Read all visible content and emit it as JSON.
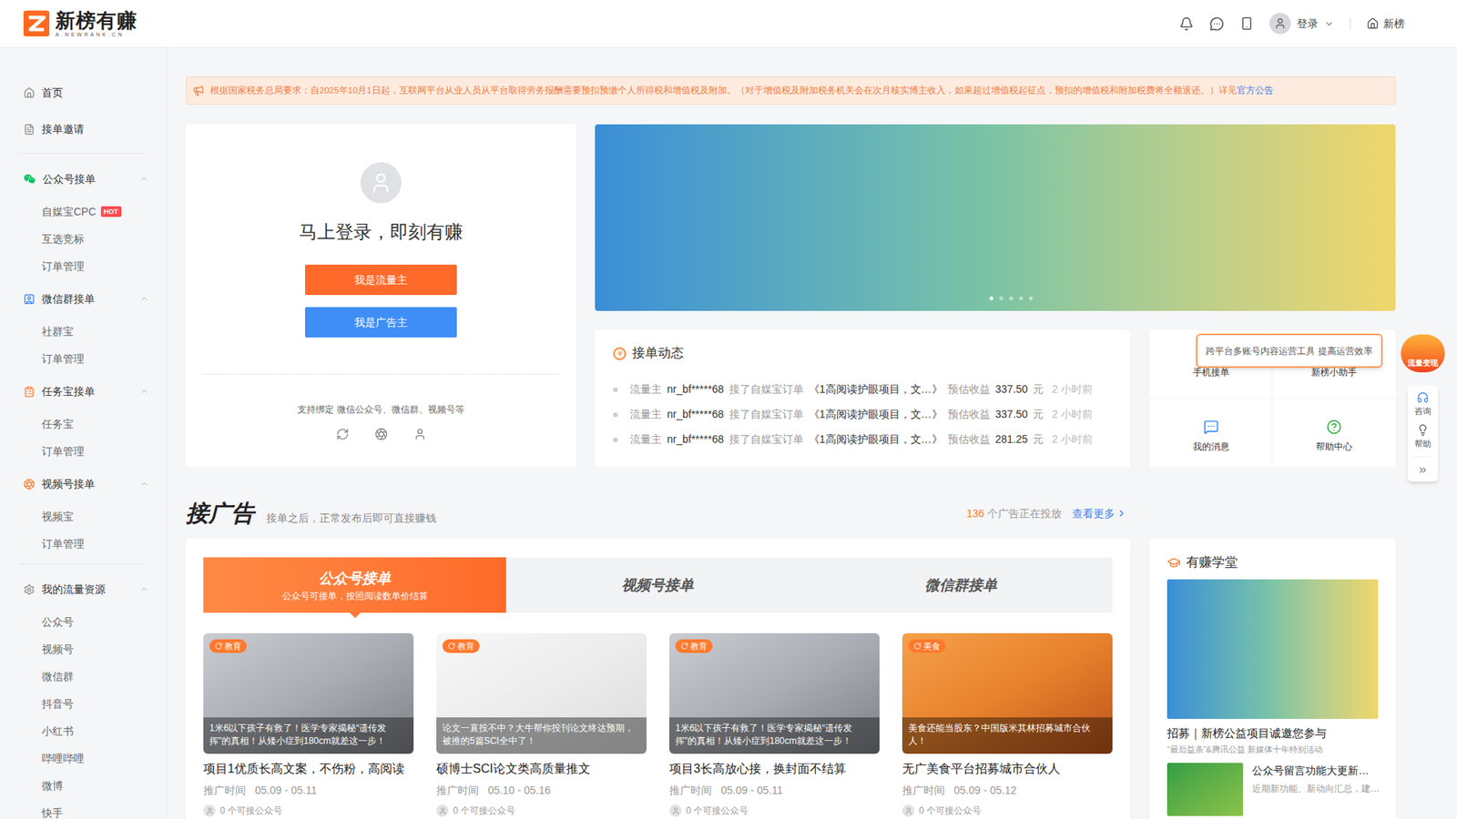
{
  "header": {
    "logo_name": "新榜有赚",
    "logo_domain": "A.NEWRANK.CN",
    "login": "登录",
    "home": "新榜"
  },
  "sidebar": {
    "top": [
      {
        "label": "首页",
        "selected": false
      },
      {
        "label": "接单邀请",
        "selected": false
      }
    ],
    "groups": [
      {
        "label": "公众号接单",
        "expanded": true,
        "items": [
          {
            "label": "自媒宝CPC",
            "badge": "HOT",
            "selected": false
          },
          {
            "label": "互选竞标",
            "badge": "",
            "selected": false
          },
          {
            "label": "订单管理",
            "badge": "",
            "selected": false
          }
        ]
      },
      {
        "label": "微信群接单",
        "expanded": true,
        "items": [
          {
            "label": "社群宝",
            "badge": "",
            "selected": false
          },
          {
            "label": "订单管理",
            "badge": "",
            "selected": false
          }
        ]
      },
      {
        "label": "任务宝接单",
        "expanded": true,
        "items": [
          {
            "label": "任务宝",
            "badge": "",
            "selected": false
          },
          {
            "label": "订单管理",
            "badge": "",
            "selected": false
          }
        ]
      },
      {
        "label": "视频号接单",
        "expanded": true,
        "items": [
          {
            "label": "视频宝",
            "badge": "",
            "selected": false
          },
          {
            "label": "订单管理",
            "badge": "",
            "selected": false
          }
        ]
      },
      {
        "label": "我的流量资源",
        "expanded": true,
        "items": [
          {
            "label": "公众号",
            "badge": "",
            "selected": false
          },
          {
            "label": "视频号",
            "badge": "",
            "selected": false
          },
          {
            "label": "微信群",
            "badge": "",
            "selected": false
          },
          {
            "label": "抖音号",
            "badge": "",
            "selected": false
          },
          {
            "label": "小红书",
            "badge": "",
            "selected": false
          },
          {
            "label": "哔哩哔哩",
            "badge": "",
            "selected": false
          },
          {
            "label": "微博",
            "badge": "",
            "selected": false
          },
          {
            "label": "快手",
            "badge": "",
            "selected": false
          }
        ]
      }
    ]
  },
  "notice": {
    "text": "根据国家税务总局要求：自2025年10月1日起，互联网平台从业人员从平台取得劳务报酬需要预扣预缴个人所得税和增值税及附加。（对于增值税及附加税务机关会在次月核实博主收入，如果超过增值税起征点，预扣的增值税和附加税费将全额退还。）详见",
    "link": "官方公告"
  },
  "login_card": {
    "title": "马上登录，即刻有赚",
    "buttons": [
      "我是流量主",
      "我是广告主"
    ],
    "bind_text": "支持绑定 微信公众号、微信群、视频号等"
  },
  "banner": {
    "dots": [
      {
        "selected": true
      },
      {
        "selected": false
      },
      {
        "selected": false
      },
      {
        "selected": false
      },
      {
        "selected": false
      }
    ]
  },
  "order_feed": {
    "title": "接单动态",
    "rows": [
      {
        "role": "流量主",
        "user": "nr_bf*****68",
        "action": "接了自媒宝订单",
        "item": "《1高阅读护眼项目，文…》",
        "label": "预估收益",
        "amount": "337.50",
        "unit": "元",
        "time": "2 小时前"
      },
      {
        "role": "流量主",
        "user": "nr_bf*****68",
        "action": "接了自媒宝订单",
        "item": "《1高阅读护眼项目，文…》",
        "label": "预估收益",
        "amount": "337.50",
        "unit": "元",
        "time": "2 小时前"
      },
      {
        "role": "流量主",
        "user": "nr_bf*****68",
        "action": "接了自媒宝订单",
        "item": "《1高阅读护眼项目，文…》",
        "label": "预估收益",
        "amount": "281.25",
        "unit": "元",
        "time": "2 小时前"
      }
    ]
  },
  "quick": {
    "tooltip": "跨平台多账号内容运营工具 提高运营效率",
    "items": [
      "手机接单",
      "新榜小助手",
      "我的消息",
      "帮助中心"
    ]
  },
  "ads": {
    "title": "接广告",
    "subtitle": "接单之后，正常发布后即可直接赚钱",
    "count": "136",
    "count_label": "个广告正在投放",
    "more": "查看更多",
    "tabs": [
      {
        "label": "公众号接单",
        "sub": "公众号可接单，按照阅读数单价结算",
        "selected": true
      },
      {
        "label": "视频号接单",
        "sub": "",
        "selected": false
      },
      {
        "label": "微信群接单",
        "sub": "",
        "selected": false
      }
    ],
    "cards": [
      {
        "tag": "教育",
        "caption": "1米6以下孩子有救了！医学专家揭秘“遗传发挥”的真相！从矮小症到180cm就差这一步！",
        "title": "项目1优质长高文案，不伤粉，高阅读",
        "time_label": "推广时间",
        "time": "05.09 - 05.11",
        "count": "0 个可接公众号"
      },
      {
        "tag": "教育",
        "caption": "论文一直投不中？大牛帮你投刊论文终达预期，被推的5篇SCI全中了！",
        "title": "硕博士SCI论文类高质量推文",
        "time_label": "推广时间",
        "time": "05.10 - 05.16",
        "count": "0 个可接公众号"
      },
      {
        "tag": "教育",
        "caption": "1米6以下孩子有救了！医学专家揭秘“遗传发挥”的真相！从矮小症到180cm就差这一步！",
        "title": "项目3长高放心接，换封面不结算",
        "time_label": "推广时间",
        "time": "05.09 - 05.11",
        "count": "0 个可接公众号"
      },
      {
        "tag": "美食",
        "caption": "美食还能当股东？中国版米其林招募城市合伙人！",
        "title": "无广美食平台招募城市合伙人",
        "time_label": "推广时间",
        "time": "05.09 - 05.12",
        "count": "0 个可接公众号"
      }
    ]
  },
  "school": {
    "title": "有赚学堂",
    "items": [
      {
        "kind": "feature",
        "title": "招募｜新榜公益项目诚邀您参与",
        "sub": "“最后益条”&腾讯公益 新媒体十年特别活动"
      },
      {
        "kind": "compact",
        "title": "公众号留言功能大更新…",
        "sub": "近期新功能、新动向汇总，建…"
      }
    ]
  },
  "float": {
    "badge": "流量变现",
    "items": [
      "咨询",
      "帮助"
    ]
  }
}
